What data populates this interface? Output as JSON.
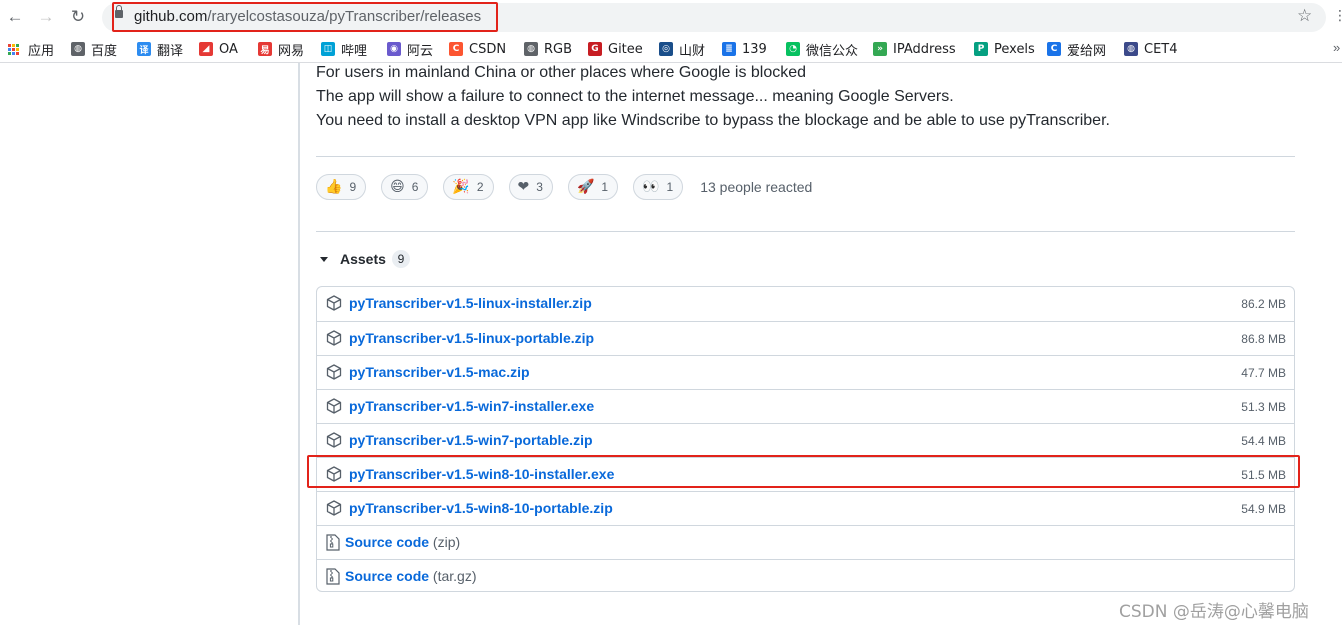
{
  "browser": {
    "back_glyph": "←",
    "forward_glyph": "→",
    "reload_glyph": "↻",
    "url_host": "github.com",
    "url_path": "/raryelcostasouza/pyTranscriber/releases",
    "star_glyph": "☆",
    "menu_glyph": "⋮"
  },
  "bookmarks": {
    "more_glyph": "»",
    "items": [
      {
        "label": "应用",
        "icon": "apps-icon",
        "color": "#4285f4"
      },
      {
        "label": "百度",
        "icon": "globe-icon",
        "color": "#5f6368",
        "glyph": "◍"
      },
      {
        "label": "翻译",
        "icon": "translate-icon",
        "color": "#2d8cf0",
        "glyph": "译"
      },
      {
        "label": "OA",
        "icon": "oa-icon",
        "color": "#e53935",
        "glyph": "◢"
      },
      {
        "label": "网易",
        "icon": "netease-icon",
        "color": "#e53935",
        "glyph": "易"
      },
      {
        "label": "哔哩",
        "icon": "bilibili-icon",
        "color": "#00a1d6",
        "glyph": "◫"
      },
      {
        "label": "阿云",
        "icon": "aliyun-icon",
        "color": "#6a5acd",
        "glyph": "◉"
      },
      {
        "label": "CSDN",
        "icon": "csdn-icon",
        "color": "#fc5531",
        "glyph": "C"
      },
      {
        "label": "RGB",
        "icon": "rgb-globe-icon",
        "color": "#5f6368",
        "glyph": "◍"
      },
      {
        "label": "Gitee",
        "icon": "gitee-icon",
        "color": "#c71d23",
        "glyph": "G"
      },
      {
        "label": "山财",
        "icon": "sdufe-icon",
        "color": "#1a4e8a",
        "glyph": "◎"
      },
      {
        "label": "139",
        "icon": "mail139-icon",
        "color": "#1a73e8",
        "glyph": "≣"
      },
      {
        "label": "微信公众",
        "icon": "wechat-icon",
        "color": "#07c160",
        "glyph": "◔"
      },
      {
        "label": "IPAddress",
        "icon": "ipaddress-icon",
        "color": "#34a853",
        "glyph": "»"
      },
      {
        "label": "Pexels",
        "icon": "pexels-icon",
        "color": "#05a081",
        "glyph": "P"
      },
      {
        "label": "爱给网",
        "icon": "aigei-icon",
        "color": "#1a73e8",
        "glyph": "C"
      },
      {
        "label": "CET4",
        "icon": "cet4-icon",
        "color": "#3c4a8a",
        "glyph": "◍"
      }
    ]
  },
  "release": {
    "description_lines": [
      "For users in mainland China or other places where Google is blocked",
      "The app will show a failure to connect to the internet message... meaning Google Servers.",
      "You need to install a desktop VPN app like Windscribe to bypass the blockage and be able to use pyTranscriber."
    ],
    "reactions": [
      {
        "emoji": "👍",
        "icon": "thumbs-up-icon",
        "count": "9"
      },
      {
        "emoji": "😄",
        "icon": "laugh-icon",
        "count": "6"
      },
      {
        "emoji": "🎉",
        "icon": "hooray-icon",
        "count": "2"
      },
      {
        "emoji": "❤",
        "icon": "heart-icon",
        "count": "3"
      },
      {
        "emoji": "🚀",
        "icon": "rocket-icon",
        "count": "1"
      },
      {
        "emoji": "👀",
        "icon": "eyes-icon",
        "count": "1"
      }
    ],
    "reacted_summary": "13 people reacted",
    "assets_title": "Assets",
    "assets_count": "9",
    "assets": [
      {
        "name": "pyTranscriber-v1.5-linux-installer.zip",
        "suffix": "",
        "size": "86.2 MB",
        "icon": "package-icon"
      },
      {
        "name": "pyTranscriber-v1.5-linux-portable.zip",
        "suffix": "",
        "size": "86.8 MB",
        "icon": "package-icon"
      },
      {
        "name": "pyTranscriber-v1.5-mac.zip",
        "suffix": "",
        "size": "47.7 MB",
        "icon": "package-icon"
      },
      {
        "name": "pyTranscriber-v1.5-win7-installer.exe",
        "suffix": "",
        "size": "51.3 MB",
        "icon": "package-icon"
      },
      {
        "name": "pyTranscriber-v1.5-win7-portable.zip",
        "suffix": "",
        "size": "54.4 MB",
        "icon": "package-icon"
      },
      {
        "name": "pyTranscriber-v1.5-win8-10-installer.exe",
        "suffix": "",
        "size": "51.5 MB",
        "icon": "package-icon"
      },
      {
        "name": "pyTranscriber-v1.5-win8-10-portable.zip",
        "suffix": "",
        "size": "54.9 MB",
        "icon": "package-icon"
      },
      {
        "name": "Source code",
        "suffix": " (zip)",
        "size": "",
        "icon": "file-zip-icon"
      },
      {
        "name": "Source code",
        "suffix": " (tar.gz)",
        "size": "",
        "icon": "file-zip-icon"
      }
    ]
  },
  "watermark": "CSDN @岳涛@心馨电脑",
  "colors": {
    "link": "#0969da",
    "highlight": "#e2231a",
    "border": "#d0d7de",
    "muted": "#57606a"
  }
}
